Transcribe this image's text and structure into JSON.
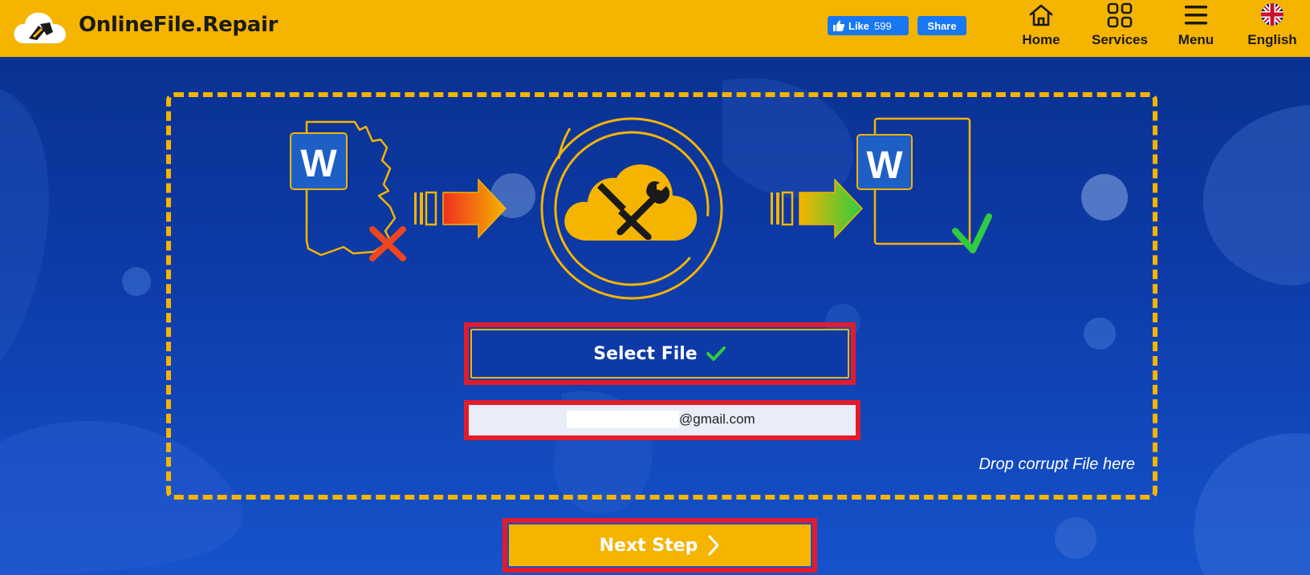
{
  "header": {
    "brand": "OnlineFile.Repair",
    "facebook": {
      "like_label": "Like",
      "like_count": "599",
      "share_label": "Share"
    },
    "nav": [
      {
        "label": "Home",
        "icon": "home-icon"
      },
      {
        "label": "Services",
        "icon": "grid-icon"
      },
      {
        "label": "Menu",
        "icon": "hamburger-icon"
      },
      {
        "label": "English",
        "icon": "uk-flag-icon"
      }
    ]
  },
  "main": {
    "illustration": {
      "left_doc_letter": "W",
      "right_doc_letter": "W",
      "icons": [
        "word-document-broken-icon",
        "x-mark-icon",
        "arrow-right-icon",
        "cloud-repair-tools-icon",
        "arrow-right-icon",
        "word-document-fixed-icon",
        "check-mark-icon"
      ]
    },
    "select_button_label": "Select File",
    "email_suffix": "@gmail.com",
    "drop_hint": "Drop corrupt File here",
    "next_button_label": "Next Step"
  },
  "colors": {
    "accent": "#f5b400",
    "background": "#0d3aa6",
    "highlight_border": "#e21c2c",
    "facebook": "#1877f2",
    "success": "#2ecc40",
    "error": "#f0451e"
  }
}
